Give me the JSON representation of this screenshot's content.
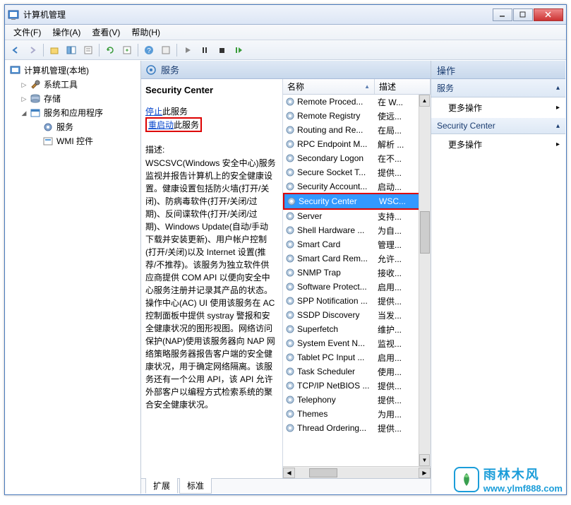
{
  "window": {
    "title": "计算机管理"
  },
  "menu": {
    "file": "文件(F)",
    "action": "操作(A)",
    "view": "查看(V)",
    "help": "帮助(H)"
  },
  "tree": {
    "root": "计算机管理(本地)",
    "systools": "系统工具",
    "storage": "存储",
    "svcapps": "服务和应用程序",
    "services": "服务",
    "wmi": "WMI 控件"
  },
  "center_header": "服务",
  "detail": {
    "title": "Security Center",
    "stop_link": "停止",
    "stop_suffix": "此服务",
    "restart_link": "重启动",
    "restart_suffix": "此服务",
    "desc_label": "描述:",
    "desc": "WSCSVC(Windows 安全中心)服务监视并报告计算机上的安全健康设置。健康设置包括防火墙(打开/关闭)、防病毒软件(打开/关闭/过期)、反间谍软件(打开/关闭/过期)、Windows Update(自动/手动下载并安装更新)、用户帐户控制(打开/关闭)以及 Internet 设置(推荐/不推荐)。该服务为独立软件供应商提供 COM API 以便向安全中心服务注册并记录其产品的状态。操作中心(AC) UI 使用该服务在 AC 控制面板中提供 systray 警报和安全健康状况的图形视图。网络访问保护(NAP)使用该服务器向 NAP 网络策略服务器报告客户端的安全健康状况，用于确定网络隔离。该服务还有一个公用 API，该 API 允许外部客户以编程方式检索系统的聚合安全健康状况。"
  },
  "list": {
    "col_name": "名称",
    "col_desc": "描述",
    "rows": [
      {
        "name": "Remote Proced...",
        "desc": "在 W..."
      },
      {
        "name": "Remote Registry",
        "desc": "使远..."
      },
      {
        "name": "Routing and Re...",
        "desc": "在局..."
      },
      {
        "name": "RPC Endpoint M...",
        "desc": "解析 ..."
      },
      {
        "name": "Secondary Logon",
        "desc": "在不..."
      },
      {
        "name": "Secure Socket T...",
        "desc": "提供..."
      },
      {
        "name": "Security Account...",
        "desc": "启动..."
      },
      {
        "name": "Security Center",
        "desc": "WSC...",
        "selected": true,
        "highlight": true
      },
      {
        "name": "Server",
        "desc": "支持..."
      },
      {
        "name": "Shell Hardware ...",
        "desc": "为自..."
      },
      {
        "name": "Smart Card",
        "desc": "管理..."
      },
      {
        "name": "Smart Card Rem...",
        "desc": "允许..."
      },
      {
        "name": "SNMP Trap",
        "desc": "接收..."
      },
      {
        "name": "Software Protect...",
        "desc": "启用..."
      },
      {
        "name": "SPP Notification ...",
        "desc": "提供..."
      },
      {
        "name": "SSDP Discovery",
        "desc": "当发..."
      },
      {
        "name": "Superfetch",
        "desc": "维护..."
      },
      {
        "name": "System Event N...",
        "desc": "监视..."
      },
      {
        "name": "Tablet PC Input ...",
        "desc": "启用..."
      },
      {
        "name": "Task Scheduler",
        "desc": "使用..."
      },
      {
        "name": "TCP/IP NetBIOS ...",
        "desc": "提供..."
      },
      {
        "name": "Telephony",
        "desc": "提供..."
      },
      {
        "name": "Themes",
        "desc": "为用..."
      },
      {
        "name": "Thread Ordering...",
        "desc": "提供..."
      }
    ]
  },
  "tabs": {
    "extended": "扩展",
    "standard": "标准"
  },
  "actions": {
    "header": "操作",
    "section1": "服务",
    "more1": "更多操作",
    "section2": "Security Center",
    "more2": "更多操作"
  },
  "watermark": {
    "title": "雨林木风",
    "url": "www.ylmf888.com"
  }
}
